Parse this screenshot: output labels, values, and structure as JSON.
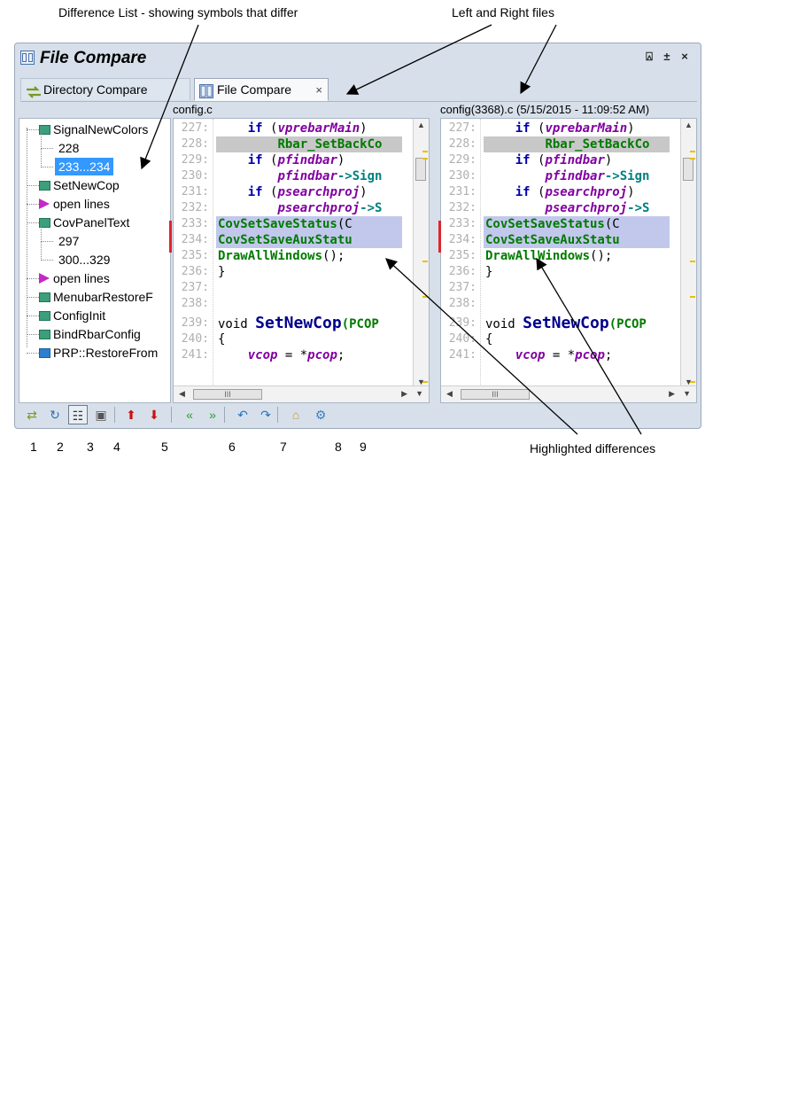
{
  "annotations": {
    "difference_list": "Difference List - showing symbols that differ",
    "left_right_files": "Left and Right files",
    "highlighted_differences": "Highlighted differences"
  },
  "window": {
    "title": "File Compare",
    "controls": {
      "pin": "⍓",
      "autohide": "±",
      "close": "×"
    }
  },
  "tabs": [
    {
      "label": "Directory Compare",
      "active": false,
      "icon": "directory-compare-icon"
    },
    {
      "label": "File Compare",
      "active": true,
      "icon": "file-compare-icon",
      "close": "×"
    }
  ],
  "files": {
    "left": "config.c",
    "right": "config(3368).c (5/15/2015 - 11:09:52 AM)"
  },
  "difference_list": [
    {
      "label": "SignalNewColors",
      "type": "function"
    },
    {
      "label": "228",
      "type": "range"
    },
    {
      "label": "233...234",
      "type": "range",
      "selected": true
    },
    {
      "label": "SetNewCop",
      "type": "function"
    },
    {
      "label": "open lines",
      "type": "open-lines"
    },
    {
      "label": "CovPanelText",
      "type": "function"
    },
    {
      "label": "297",
      "type": "range"
    },
    {
      "label": "300...329",
      "type": "range"
    },
    {
      "label": "open lines",
      "type": "open-lines"
    },
    {
      "label": "MenubarRestoreF",
      "type": "function"
    },
    {
      "label": "ConfigInit",
      "type": "function"
    },
    {
      "label": "BindRbarConfig",
      "type": "function"
    },
    {
      "label": "PRP::RestoreFrom",
      "type": "method"
    }
  ],
  "code_lines": [
    {
      "n": "227:",
      "parts": [
        [
          "",
          "    "
        ],
        [
          "kw",
          "if "
        ],
        [
          "",
          "("
        ],
        [
          "var",
          "vprebarMain"
        ],
        [
          "",
          ")"
        ]
      ]
    },
    {
      "n": "228:",
      "hl": "gray",
      "parts": [
        [
          "",
          "        "
        ],
        [
          "fn",
          "Rbar_SetBackCo"
        ]
      ]
    },
    {
      "n": "229:",
      "parts": [
        [
          "",
          "    "
        ],
        [
          "kw",
          "if "
        ],
        [
          "",
          "("
        ],
        [
          "var",
          "pfindbar"
        ],
        [
          "",
          ")"
        ]
      ]
    },
    {
      "n": "230:",
      "parts": [
        [
          "",
          "        "
        ],
        [
          "var",
          "pfindbar"
        ],
        [
          "ptr",
          "->Sign"
        ]
      ]
    },
    {
      "n": "231:",
      "parts": [
        [
          "",
          "    "
        ],
        [
          "kw",
          "if "
        ],
        [
          "",
          "("
        ],
        [
          "var",
          "psearchproj"
        ],
        [
          "",
          ")"
        ]
      ]
    },
    {
      "n": "232:",
      "parts": [
        [
          "",
          "        "
        ],
        [
          "var",
          "psearchproj"
        ],
        [
          "ptr",
          "->S"
        ]
      ]
    },
    {
      "n": "233:",
      "hl": "blue",
      "parts": [
        [
          "fn",
          "CovSetSaveStatus"
        ],
        [
          "",
          "(C"
        ]
      ]
    },
    {
      "n": "234:",
      "hl": "blue",
      "parts": [
        [
          "fn",
          "CovSetSaveAuxStatu"
        ]
      ]
    },
    {
      "n": "235:",
      "parts": [
        [
          "fn",
          "DrawAllWindows"
        ],
        [
          "",
          "();"
        ]
      ]
    },
    {
      "n": "236:",
      "parts": [
        [
          "",
          "}"
        ]
      ]
    },
    {
      "n": "237:",
      "parts": []
    },
    {
      "n": "238:",
      "parts": []
    },
    {
      "n": "239:",
      "parts": [
        [
          "",
          "void "
        ],
        [
          "big",
          "SetNewCop"
        ],
        [
          "fn",
          "(PCOP"
        ]
      ]
    },
    {
      "n": "240:",
      "parts": [
        [
          "",
          "{"
        ]
      ]
    },
    {
      "n": "241:",
      "parts": [
        [
          "",
          "    "
        ],
        [
          "var",
          "vcop"
        ],
        [
          "",
          " = *"
        ],
        [
          "var",
          "pcop"
        ],
        [
          "",
          ";"
        ]
      ]
    }
  ],
  "toolbar": {
    "buttons": [
      {
        "name": "directory-compare-button",
        "icon": "directory-compare-icon",
        "glyph": "⇄",
        "color": "#7a9a20"
      },
      {
        "name": "refresh-button",
        "icon": "refresh-icon",
        "glyph": "↻",
        "color": "#2c6fb8"
      },
      {
        "name": "sync-scroll-button",
        "icon": "sync-scroll-icon",
        "glyph": "☷",
        "color": "#333333"
      },
      {
        "name": "read-only-button",
        "icon": "lock-icon",
        "glyph": "▣",
        "color": "#555555"
      },
      {
        "name": "previous-difference-button",
        "icon": "arrow-up-icon",
        "glyph": "⬆",
        "color": "#cc1111"
      },
      {
        "name": "next-difference-button",
        "icon": "arrow-down-icon",
        "glyph": "⬇",
        "color": "#cc1111"
      },
      {
        "name": "copy-to-left-button",
        "icon": "chevrons-left-icon",
        "glyph": "«",
        "color": "#2a9a2a"
      },
      {
        "name": "copy-to-right-button",
        "icon": "chevrons-right-icon",
        "glyph": "»",
        "color": "#2a9a2a"
      },
      {
        "name": "undo-button",
        "icon": "undo-icon",
        "glyph": "↶",
        "color": "#2f6fc4"
      },
      {
        "name": "redo-button",
        "icon": "redo-icon",
        "glyph": "↷",
        "color": "#2f6fc4"
      },
      {
        "name": "open-file-button",
        "icon": "open-folder-icon",
        "glyph": "⌂",
        "color": "#c89a2a"
      },
      {
        "name": "settings-button",
        "icon": "gear-icon",
        "glyph": "⚙",
        "color": "#3a7fc4"
      }
    ]
  },
  "number_labels": [
    "1",
    "2",
    "3",
    "4",
    "5",
    "6",
    "7",
    "8",
    "9"
  ]
}
